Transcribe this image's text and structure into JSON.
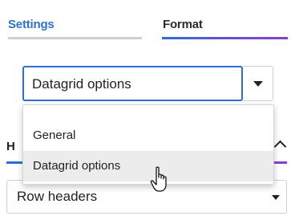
{
  "tabs": [
    {
      "label": "Settings",
      "active": false
    },
    {
      "label": "Format",
      "active": true
    }
  ],
  "select": {
    "value": "Datagrid options"
  },
  "dropdown": {
    "options": [
      "General",
      "Datagrid options"
    ],
    "highlighted": "Datagrid options"
  },
  "background": {
    "section_heading_partial": "H",
    "row_select_value": "Row headers"
  },
  "colors": {
    "accent_blue": "#2f6fd4",
    "accent_purple": "#8b3fd0",
    "hover_bg": "#ececec"
  },
  "icons": [
    "chevron-down-icon",
    "chevron-up-icon",
    "pointer-hand-cursor-icon"
  ]
}
